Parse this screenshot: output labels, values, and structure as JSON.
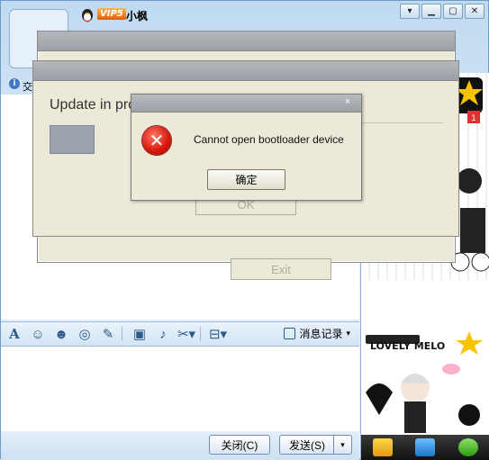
{
  "window": {
    "vip_badge": "VIP5",
    "nickname": "小枫",
    "info_text": "交"
  },
  "toolbar": {
    "font_icon": "A",
    "history_label": "消息记录"
  },
  "buttons": {
    "close_label": "关闭(C)",
    "send_label": "发送(S)"
  },
  "update_dialog": {
    "text": "Update in pro",
    "ok_label": "OK",
    "exit_label": "Exit"
  },
  "error_dialog": {
    "message": "Cannot open bootloader device",
    "ok_label": "确定",
    "close_glyph": "×"
  },
  "sidebar": {
    "badge": "1",
    "caption": "LOVELY MELO"
  },
  "colors": {
    "accent": "#3d79c4",
    "error_red": "#d4160a",
    "dialog_bg": "#ece9d8"
  }
}
